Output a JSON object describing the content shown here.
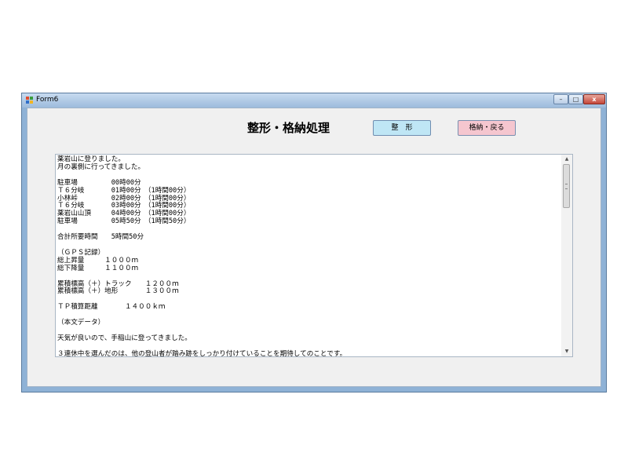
{
  "window": {
    "title": "Form6",
    "controls": {
      "minimize": "–",
      "maximize": "□",
      "close": "x"
    }
  },
  "form": {
    "heading": "整形・格納処理",
    "buttons": {
      "shape": "整　形",
      "store_back": "格納・戻る"
    }
  },
  "textbox": {
    "content": "薬岩山に登りました。\n月の裏側に行ってきました。\n\n駐車場　　　　　00時00分\nＴ６分岐　　　　01時00分　（1時間00分）\n小林峠　　　　　02時00分　（1時間00分）\nＴ６分岐　　　　03時00分　（1時間00分）\n薬岩山山頂　　　04時00分　（1時間00分）\n駐車場　　　　　05時50分　（1時間50分）\n\n合計所要時間　　5時間50分\n\n（ＧＰＳ記録）\n総上昇量　　　１０００ｍ\n総下降量　　　１１００ｍ\n\n累積標高（＋）トラック　　１２００ｍ\n累積標高（＋）地形　　　　１３００ｍ\n\nＴＰ積算距離　　　　１４００ｋｍ\n\n（本文データ）\n\n天気が良いので、手稲山に登ってきました。\n\n３連休中を選んだのは、他の登山者が踏み跡をしっかり付けていることを期待してのことです。",
    "scroll": {
      "up": "▲",
      "down": "▼"
    }
  }
}
